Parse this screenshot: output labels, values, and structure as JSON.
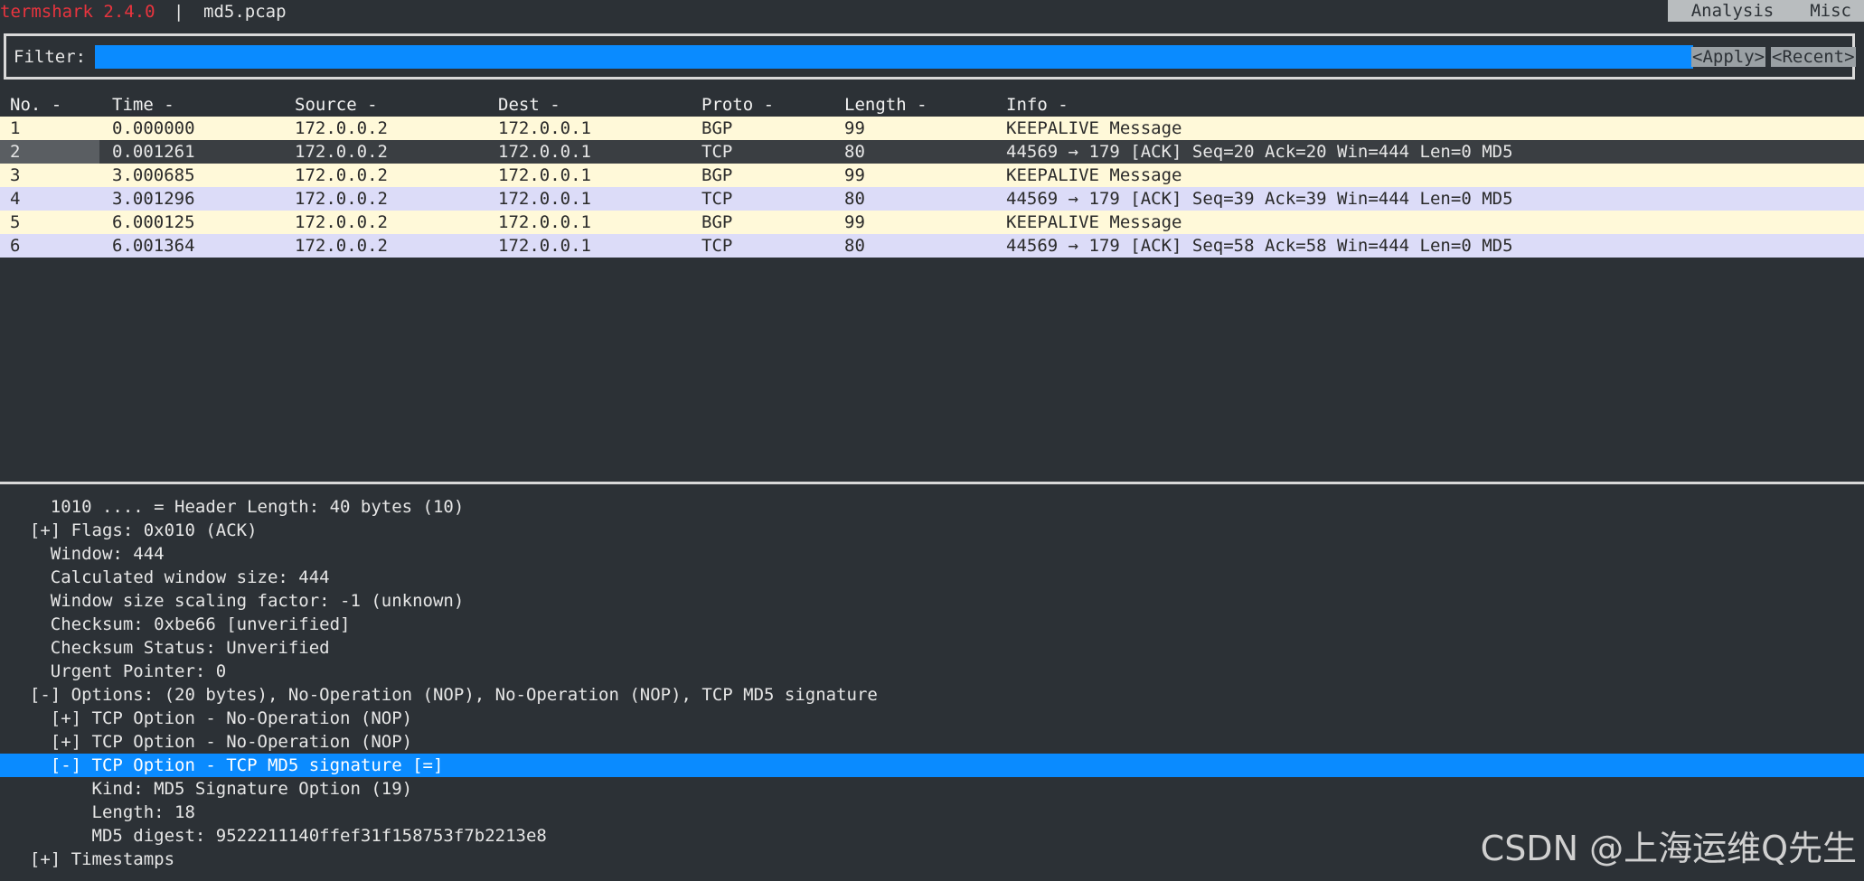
{
  "titlebar": {
    "app": "termshark 2.4.0",
    "separator": "|",
    "file": "md5.pcap",
    "menu": [
      "Analysis",
      "Misc"
    ]
  },
  "filter": {
    "label": "Filter:",
    "value": "",
    "apply": "<Apply>",
    "recent": "<Recent>"
  },
  "columns": [
    "No. -",
    "Time -",
    "Source -",
    "Dest -",
    "Proto -",
    "Length -",
    "Info -"
  ],
  "packets": [
    {
      "no": "1",
      "time": "0.000000",
      "src": "172.0.0.2",
      "dst": "172.0.0.1",
      "proto": "BGP",
      "len": "99",
      "info": "KEEPALIVE Message"
    },
    {
      "no": "2",
      "time": "0.001261",
      "src": "172.0.0.2",
      "dst": "172.0.0.1",
      "proto": "TCP",
      "len": "80",
      "info": "44569 → 179 [ACK] Seq=20 Ack=20 Win=444 Len=0 MD5"
    },
    {
      "no": "3",
      "time": "3.000685",
      "src": "172.0.0.2",
      "dst": "172.0.0.1",
      "proto": "BGP",
      "len": "99",
      "info": "KEEPALIVE Message"
    },
    {
      "no": "4",
      "time": "3.001296",
      "src": "172.0.0.2",
      "dst": "172.0.0.1",
      "proto": "TCP",
      "len": "80",
      "info": "44569 → 179 [ACK] Seq=39 Ack=39 Win=444 Len=0 MD5"
    },
    {
      "no": "5",
      "time": "6.000125",
      "src": "172.0.0.2",
      "dst": "172.0.0.1",
      "proto": "BGP",
      "len": "99",
      "info": "KEEPALIVE Message"
    },
    {
      "no": "6",
      "time": "6.001364",
      "src": "172.0.0.2",
      "dst": "172.0.0.1",
      "proto": "TCP",
      "len": "80",
      "info": "44569 → 179 [ACK] Seq=58 Ack=58 Win=444 Len=0 MD5"
    }
  ],
  "tree": [
    {
      "text": "    1010 .... = Header Length: 40 bytes (10)"
    },
    {
      "text": "  [+] Flags: 0x010 (ACK)"
    },
    {
      "text": "    Window: 444"
    },
    {
      "text": "    Calculated window size: 444"
    },
    {
      "text": "    Window size scaling factor: -1 (unknown)"
    },
    {
      "text": "    Checksum: 0xbe66 [unverified]"
    },
    {
      "text": "    Checksum Status: Unverified"
    },
    {
      "text": "    Urgent Pointer: 0"
    },
    {
      "text": "  [-] Options: (20 bytes), No-Operation (NOP), No-Operation (NOP), TCP MD5 signature"
    },
    {
      "text": "    [+] TCP Option - No-Operation (NOP)"
    },
    {
      "text": "    [+] TCP Option - No-Operation (NOP)"
    },
    {
      "text": "    [-] TCP Option - TCP MD5 signature [=]",
      "selected": true
    },
    {
      "text": "        Kind: MD5 Signature Option (19)"
    },
    {
      "text": "        Length: 18"
    },
    {
      "text": "        MD5 digest: 9522211140ffef31f158753f7b2213e8"
    },
    {
      "text": "  [+] Timestamps"
    }
  ],
  "watermark": "CSDN @上海运维Q先生",
  "colors": {
    "accent": "#0a8bff",
    "title": "#e8343e",
    "bgp_row": "#fff9d9",
    "tcp_row": "#dcdcf8",
    "background": "#2c3136"
  }
}
